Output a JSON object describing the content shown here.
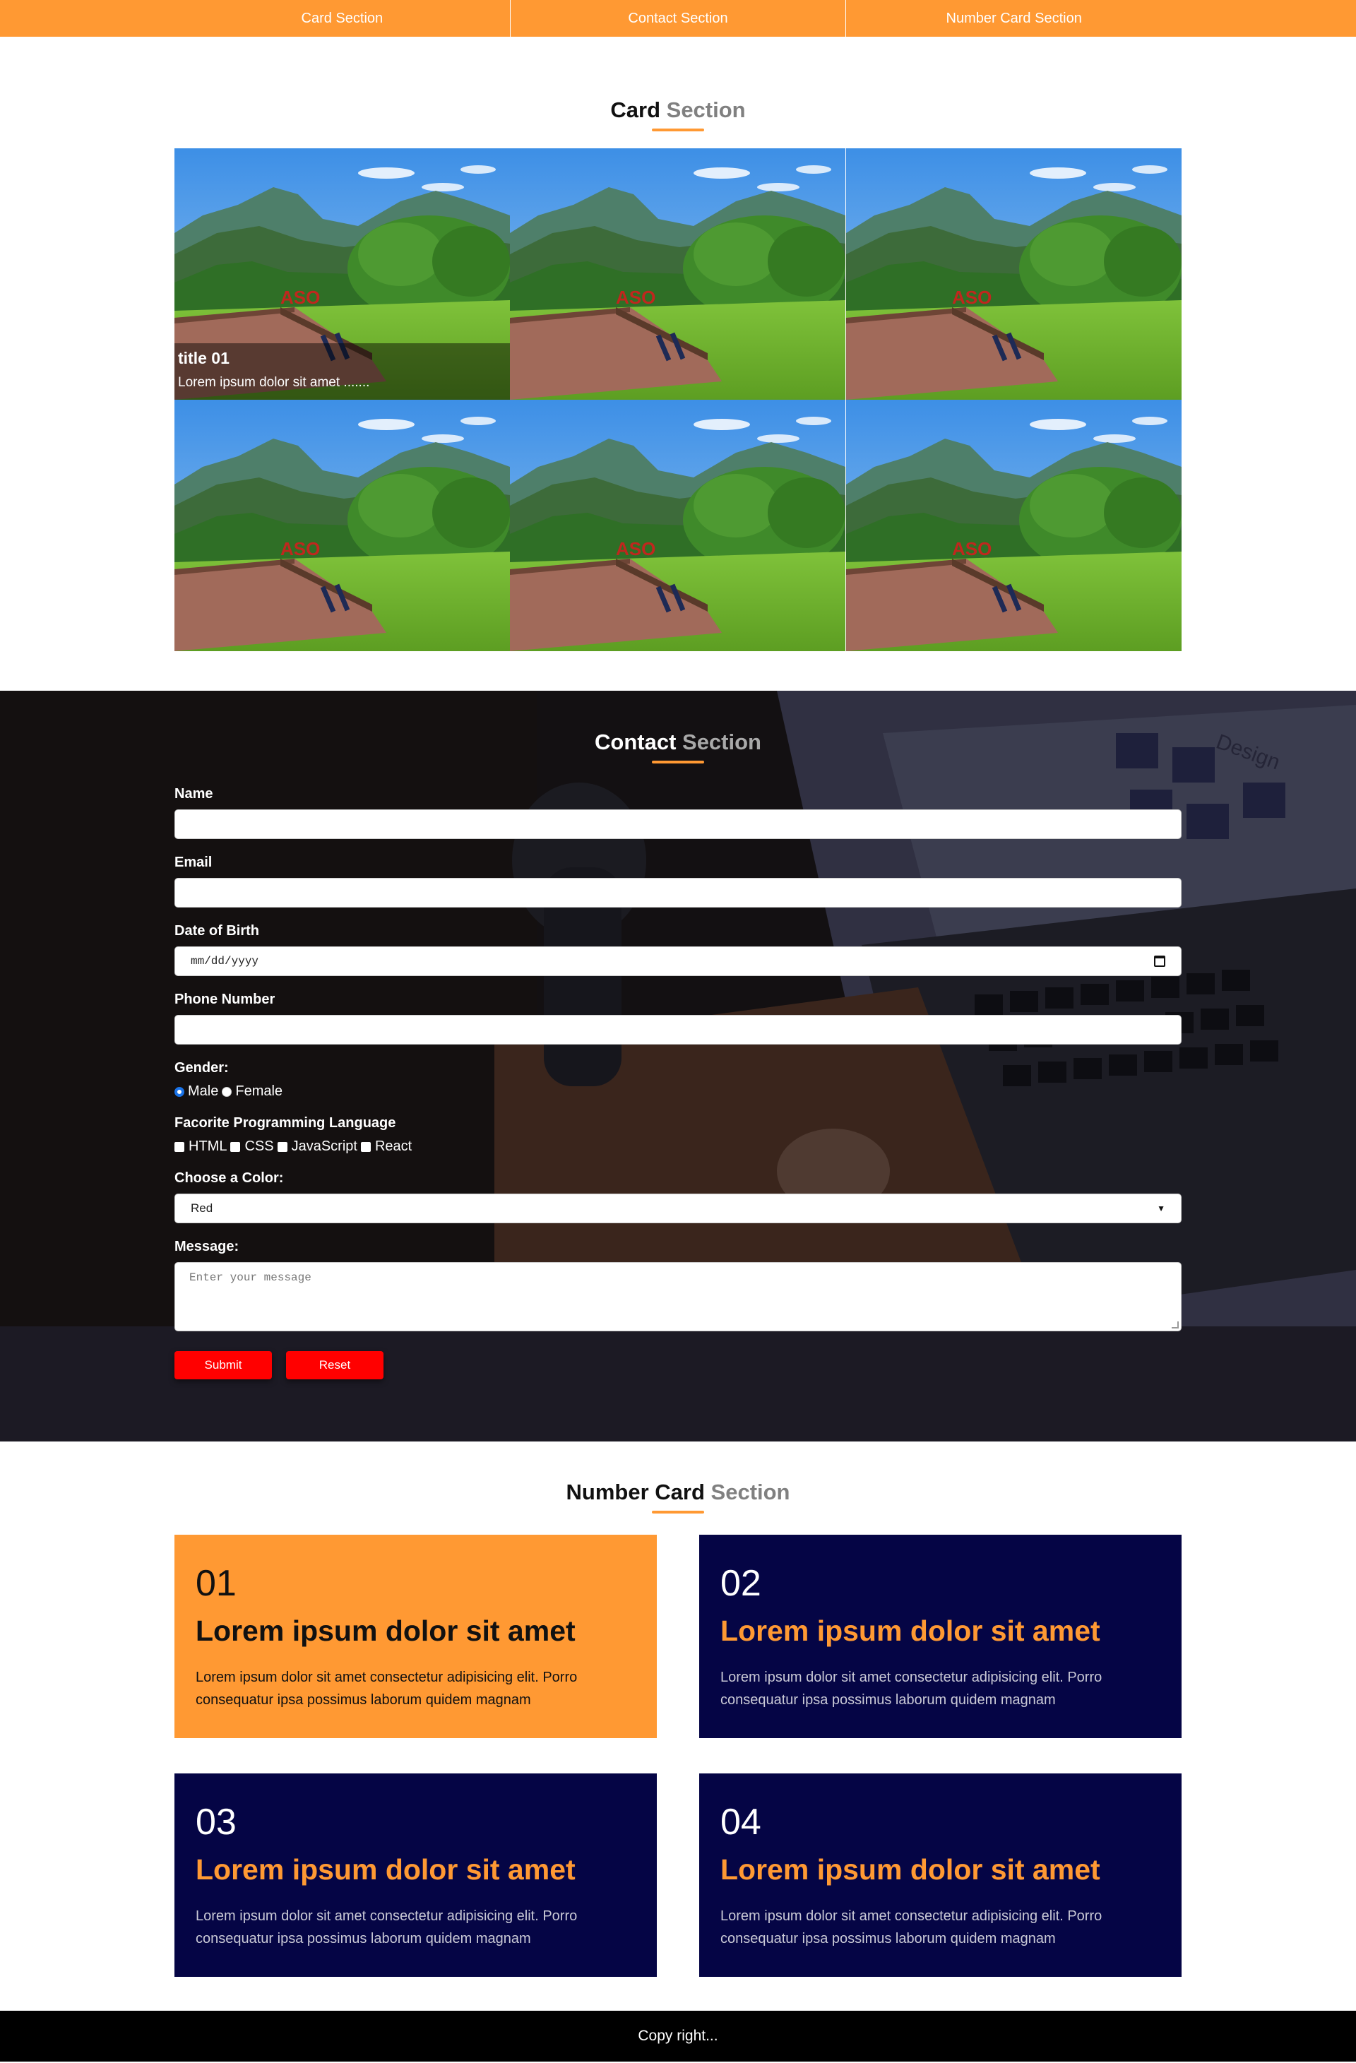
{
  "nav": {
    "items": [
      "Card Section",
      "Contact Section",
      "Number Card Section"
    ],
    "background": "#ff9933"
  },
  "card_section": {
    "title_part1": "Card",
    "title_part2": "Section",
    "cards": [
      {
        "title": "title 01",
        "desc": "Lorem ipsum dolor sit amet ......."
      }
    ],
    "image_sign": "ASO"
  },
  "contact_section": {
    "title_part1": "Contact",
    "title_part2": "Section",
    "fields": {
      "name_label": "Name",
      "email_label": "Email",
      "dob_label": "Date of Birth",
      "dob_placeholder": "mm/dd/yyyy",
      "phone_label": "Phone Number",
      "gender_label": "Gender:",
      "gender_options": [
        "Male",
        "Female"
      ],
      "gender_selected": "Male",
      "lang_label": "Facorite Programming Language",
      "lang_options": [
        "HTML",
        "CSS",
        "JavaScript",
        "React"
      ],
      "color_label": "Choose a Color:",
      "color_selected": "Red",
      "message_label": "Message:",
      "message_placeholder": "Enter your message"
    },
    "buttons": {
      "submit": "Submit",
      "reset": "Reset"
    },
    "bg_text": "Design"
  },
  "number_section": {
    "title_part1": "Number",
    "title_part2": "Card",
    "title_part3": "Section",
    "cards": [
      {
        "num": "01",
        "title": "Lorem ipsum dolor sit amet",
        "desc": "Lorem ipsum dolor sit amet consectetur adipisicing elit. Porro consequatur ipsa possimus laborum quidem magnam"
      },
      {
        "num": "02",
        "title": "Lorem ipsum dolor sit amet",
        "desc": "Lorem ipsum dolor sit amet consectetur adipisicing elit. Porro consequatur ipsa possimus laborum quidem magnam"
      },
      {
        "num": "03",
        "title": "Lorem ipsum dolor sit amet",
        "desc": "Lorem ipsum dolor sit amet consectetur adipisicing elit. Porro consequatur ipsa possimus laborum quidem magnam"
      },
      {
        "num": "04",
        "title": "Lorem ipsum dolor sit amet",
        "desc": "Lorem ipsum dolor sit amet consectetur adipisicing elit. Porro consequatur ipsa possimus laborum quidem magnam"
      }
    ],
    "colors": {
      "accent": "#ff9933",
      "dark": "#050545"
    }
  },
  "footer": {
    "text": "Copy right..."
  }
}
